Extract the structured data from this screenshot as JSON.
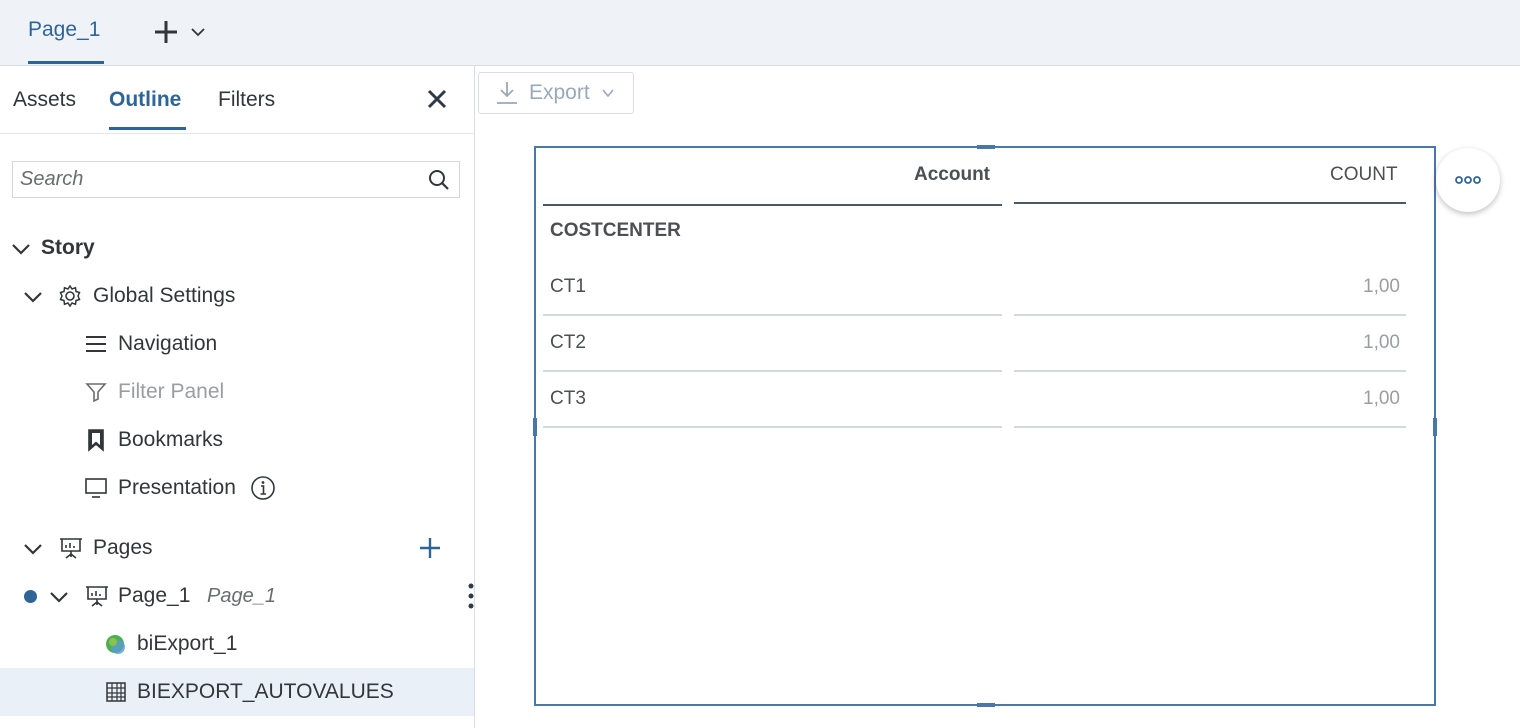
{
  "top_tabs": {
    "active_page": "Page_1"
  },
  "left_panel": {
    "tabs": [
      "Assets",
      "Outline",
      "Filters"
    ],
    "active_tab": "Outline",
    "search_placeholder": "Search",
    "tree": {
      "story": "Story",
      "global_settings": "Global Settings",
      "navigation": "Navigation",
      "filter_panel": "Filter Panel",
      "bookmarks": "Bookmarks",
      "presentation": "Presentation",
      "pages": "Pages",
      "page_1": "Page_1",
      "page_1_alias": "Page_1",
      "biexport": "biExport_1",
      "biexport_autovalues": "BIEXPORT_AUTOVALUES"
    }
  },
  "toolbar": {
    "export_label": "Export"
  },
  "table": {
    "headers": [
      "Account",
      "COUNT"
    ],
    "group_label": "COSTCENTER",
    "rows": [
      {
        "account": "CT1",
        "count": "1,00"
      },
      {
        "account": "CT2",
        "count": "1,00"
      },
      {
        "account": "CT3",
        "count": "1,00"
      }
    ]
  },
  "colors": {
    "accent": "#2f6497",
    "selection_border": "#4a77a8",
    "top_bar_bg": "#eff3f8",
    "selected_row_bg": "#eaf0f7"
  }
}
